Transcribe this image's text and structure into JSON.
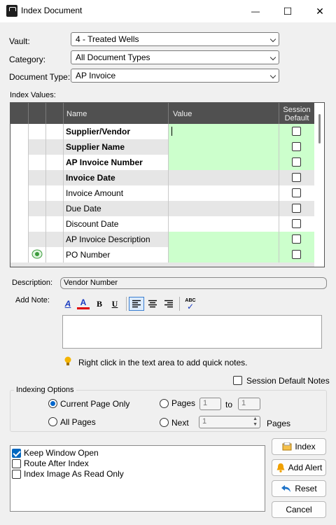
{
  "window": {
    "title": "Index Document",
    "minimize_glyph": "—",
    "maximize_glyph": "☐",
    "close_glyph": "✕"
  },
  "form": {
    "vault_label": "Vault:",
    "vault_value": "4 - Treated Wells",
    "category_label": "Category:",
    "category_value": "All Document Types",
    "doctype_label": "Document Type:",
    "doctype_value": "AP Invoice",
    "index_values_label": "Index Values:"
  },
  "grid": {
    "columns": {
      "name": "Name",
      "value": "Value",
      "session_default_1": "Session",
      "session_default_2": "Default"
    },
    "rows": [
      {
        "name": "Supplier/Vendor",
        "bold": true,
        "value_green": true,
        "alt": false,
        "focused": true
      },
      {
        "name": "Supplier Name",
        "bold": true,
        "value_green": true,
        "alt": true
      },
      {
        "name": "AP Invoice Number",
        "bold": true,
        "value_green": true,
        "alt": false
      },
      {
        "name": "Invoice Date",
        "bold": true,
        "value_green": false,
        "alt": true
      },
      {
        "name": "Invoice Amount",
        "bold": false,
        "value_green": false,
        "alt": false
      },
      {
        "name": "Due Date",
        "bold": false,
        "value_green": false,
        "alt": true
      },
      {
        "name": "Discount Date",
        "bold": false,
        "value_green": false,
        "alt": false
      },
      {
        "name": "AP Invoice Description",
        "bold": false,
        "value_green": true,
        "alt": true
      },
      {
        "name": "PO Number",
        "bold": false,
        "value_green": true,
        "alt": false,
        "add_icon": true
      }
    ]
  },
  "description": {
    "label": "Description:",
    "value": "Vendor Number"
  },
  "note": {
    "label": "Add Note:",
    "toolbar": {
      "font_glyph": "A",
      "color_glyph": "A",
      "bold_glyph": "B",
      "underline_glyph": "U",
      "spell_glyph": "ABC"
    },
    "hint": "Right click in the text area to add quick notes.",
    "session_default_notes": "Session Default Notes"
  },
  "indexing": {
    "legend": "Indexing Options",
    "current_page": "Current Page Only",
    "all_pages": "All Pages",
    "pages_label": "Pages",
    "from_value": "1",
    "to_label": "to",
    "to_value": "1",
    "next_label": "Next",
    "next_value": "1",
    "pages_suffix": "Pages"
  },
  "options": [
    {
      "label": "Keep Window Open",
      "checked": true
    },
    {
      "label": "Route After Index",
      "checked": false
    },
    {
      "label": "Index Image As Read Only",
      "checked": false
    }
  ],
  "buttons": {
    "index": "Index",
    "add_alert": "Add Alert",
    "reset": "Reset",
    "cancel": "Cancel"
  },
  "colors": {
    "required_green": "#ccffcc",
    "header_gray": "#505050",
    "radio_blue": "#0066cc",
    "check_blue": "#0067c0"
  }
}
